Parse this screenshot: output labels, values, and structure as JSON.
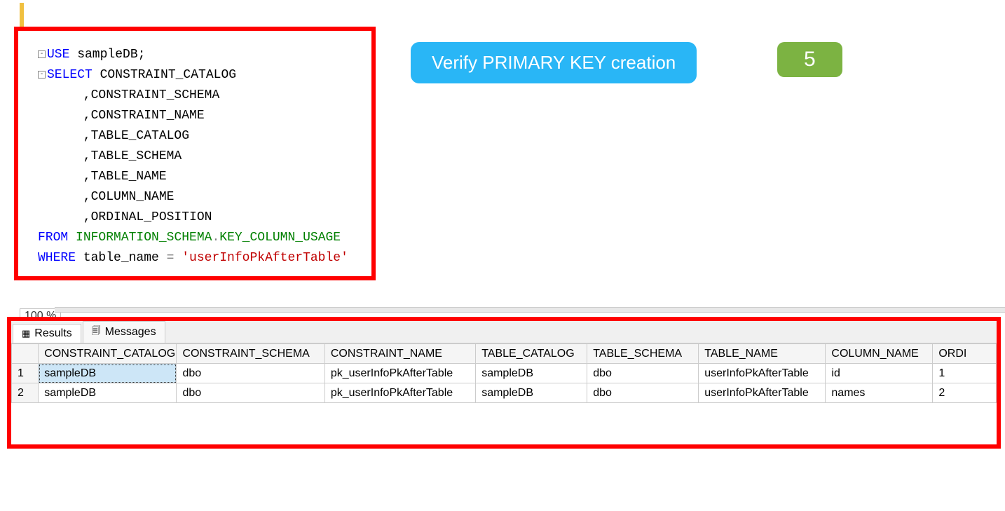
{
  "annotation": {
    "banner": "Verify PRIMARY KEY creation",
    "step": "5"
  },
  "zoom": "100 %",
  "sql": {
    "use_kw": "USE",
    "use_db": " sampleDB",
    "semi": ";",
    "select_kw": "SELECT",
    "from_kw": "FROM",
    "where_kw": "WHERE",
    "eq": " = ",
    "dot": ".",
    "cols": {
      "c0": " CONSTRAINT_CATALOG",
      "c1": "      ,CONSTRAINT_SCHEMA",
      "c2": "      ,CONSTRAINT_NAME",
      "c3": "      ,TABLE_CATALOG",
      "c4": "      ,TABLE_SCHEMA",
      "c5": "      ,TABLE_NAME",
      "c6": "      ,COLUMN_NAME",
      "c7": "      ,ORDINAL_POSITION"
    },
    "from_schema": " INFORMATION_SCHEMA",
    "from_view": "KEY_COLUMN_USAGE",
    "where_col": " table_name",
    "where_val": "'userInfoPkAfterTable'"
  },
  "result_tabs": {
    "results": "Results",
    "messages": "Messages"
  },
  "grid": {
    "headers": {
      "cc": "CONSTRAINT_CATALOG",
      "cs": "CONSTRAINT_SCHEMA",
      "cn": "CONSTRAINT_NAME",
      "tc": "TABLE_CATALOG",
      "ts": "TABLE_SCHEMA",
      "tn": "TABLE_NAME",
      "coln": "COLUMN_NAME",
      "op": "ORDI"
    },
    "rows": [
      {
        "n": "1",
        "cc": "sampleDB",
        "cs": "dbo",
        "cn": "pk_userInfoPkAfterTable",
        "tc": "sampleDB",
        "ts": "dbo",
        "tn": "userInfoPkAfterTable",
        "coln": "id",
        "op": "1"
      },
      {
        "n": "2",
        "cc": "sampleDB",
        "cs": "dbo",
        "cn": "pk_userInfoPkAfterTable",
        "tc": "sampleDB",
        "ts": "dbo",
        "tn": "userInfoPkAfterTable",
        "coln": "names",
        "op": "2"
      }
    ]
  }
}
